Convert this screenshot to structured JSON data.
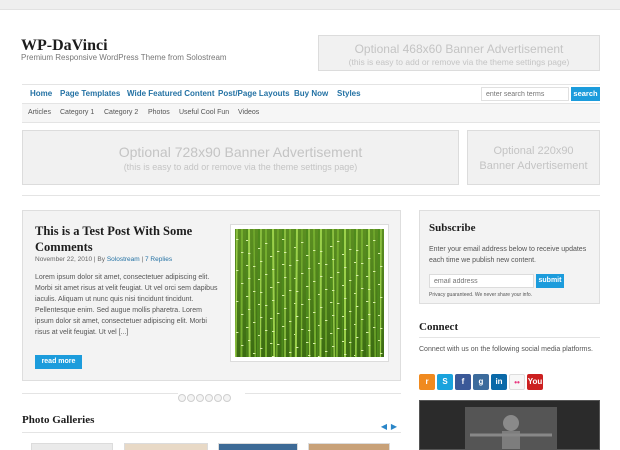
{
  "header": {
    "site_title": "WP-DaVinci",
    "tagline": "Premium Responsive WordPress Theme from Solostream"
  },
  "ads": {
    "top": {
      "title": "Optional 468x60 Banner Advertisement",
      "note": "(this is easy to add or remove via the theme settings page)"
    },
    "wide": {
      "title": "Optional 728x90 Banner Advertisement",
      "note": "(this is easy to add or remove via the theme settings page)"
    },
    "side": {
      "title_line1": "Optional 220x90",
      "title_line2": "Banner Advertisement"
    }
  },
  "nav_main": {
    "items": [
      {
        "label": "Home"
      },
      {
        "label": "Page Templates"
      },
      {
        "label": "Wide Featured Content"
      },
      {
        "label": "Post/Page Layouts"
      },
      {
        "label": "Buy Now"
      },
      {
        "label": "Styles"
      }
    ]
  },
  "search": {
    "placeholder": "enter search terms",
    "button_label": "search"
  },
  "nav_sub": {
    "items": [
      {
        "label": "Articles"
      },
      {
        "label": "Category 1"
      },
      {
        "label": "Category 2"
      },
      {
        "label": "Photos"
      },
      {
        "label": "Useful Cool Fun"
      },
      {
        "label": "Videos"
      }
    ]
  },
  "featured_post": {
    "title": "This is a Test Post With Some Comments",
    "date": "November 22, 2010",
    "by_prefix": "| By",
    "author": "Solostream",
    "separator": "|",
    "replies": "7 Replies",
    "excerpt": "Lorem ipsum dolor sit amet, consectetuer adipiscing elit. Morbi sit amet risus at velit feugiat. Ut vel orci sem dapibus iaculis. Aliquam ut nunc quis nisi tincidunt tincidunt. Pellentesque enim. Sed augue mollis pharetra. Lorem ipsum dolor sit amet, consectetuer adipiscing elit. Morbi risus at velit feugiat. Ut vel [...]",
    "read_more": "read more",
    "image": "bamboo-grass-photo"
  },
  "slider_dots_count": 6,
  "photo_galleries": {
    "title": "Photo Galleries",
    "prev_icon": "arrow-left-icon",
    "next_icon": "arrow-right-icon"
  },
  "subscribe": {
    "title": "Subscribe",
    "description": "Enter your email address below to receive updates each time we publish new content.",
    "email_placeholder": "email address",
    "submit_label": "submit",
    "privacy": "Privacy guaranteed. We never share your info."
  },
  "connect": {
    "title": "Connect",
    "description": "Connect with us on the following social media platforms.",
    "icons": [
      {
        "name": "rss-icon",
        "glyph": "r",
        "color": "#f08a1f"
      },
      {
        "name": "skype-icon",
        "glyph": "S",
        "color": "#1aa3dd"
      },
      {
        "name": "facebook-icon",
        "glyph": "f",
        "color": "#3b5998"
      },
      {
        "name": "google-plus-icon",
        "glyph": "g",
        "color": "#3c6b9c"
      },
      {
        "name": "linkedin-icon",
        "glyph": "in",
        "color": "#0a69a8"
      },
      {
        "name": "flickr-icon",
        "glyph": "••",
        "color": "#f7f7f7"
      },
      {
        "name": "youtube-icon",
        "glyph": "You",
        "color": "#cc2020"
      }
    ]
  },
  "colors": {
    "accent": "#1c9cdc",
    "link": "#2472a4",
    "panel_bg": "#f3f3f3"
  }
}
